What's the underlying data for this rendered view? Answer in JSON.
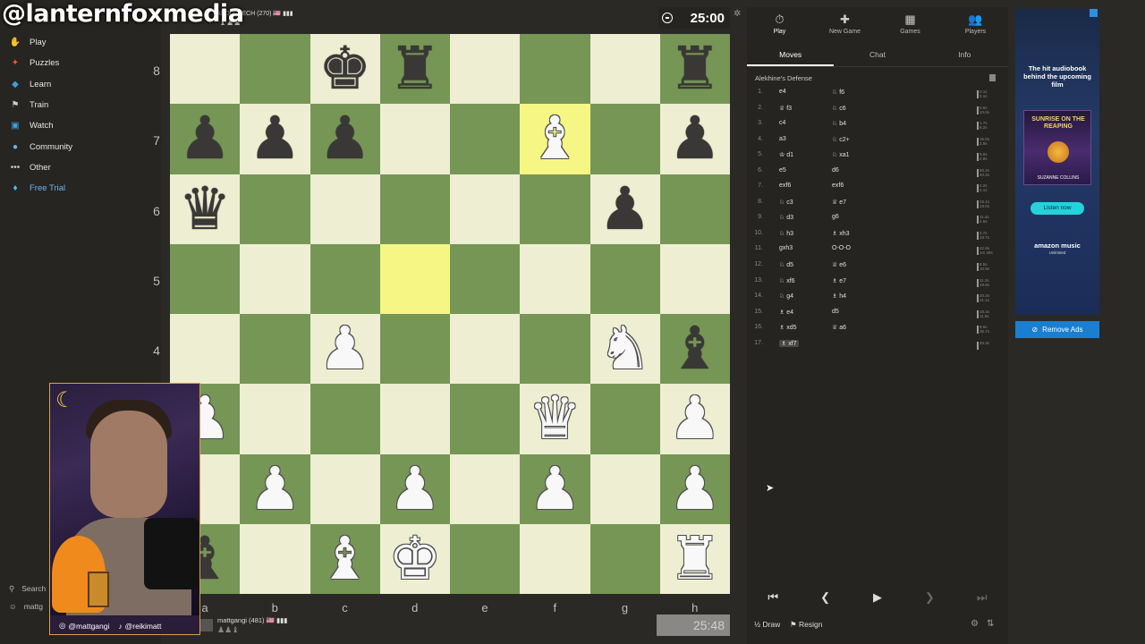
{
  "watermark": "@lanternfoxmedia",
  "nav": {
    "items": [
      {
        "label": "Play",
        "icon": "play-hand-icon",
        "glyph": "✋",
        "color": "#f0a03c"
      },
      {
        "label": "Puzzles",
        "icon": "puzzle-icon",
        "glyph": "✦",
        "color": "#e8593a"
      },
      {
        "label": "Learn",
        "icon": "learn-icon",
        "glyph": "◆",
        "color": "#3aa0e0"
      },
      {
        "label": "Train",
        "icon": "train-icon",
        "glyph": "⚑",
        "color": "#c9c9c9"
      },
      {
        "label": "Watch",
        "icon": "watch-icon",
        "glyph": "▣",
        "color": "#3aa0e0"
      },
      {
        "label": "Community",
        "icon": "community-icon",
        "glyph": "●",
        "color": "#6fb3e8"
      },
      {
        "label": "Other",
        "icon": "more-icon",
        "glyph": "•••",
        "color": "#c9c9c9"
      },
      {
        "label": "Free Trial",
        "icon": "diamond-icon",
        "glyph": "♦",
        "color": "#3ac8e8"
      }
    ],
    "search": "Search",
    "user": "mattg"
  },
  "opponent": {
    "name": "ANDO_TECH (270) 🇺🇸 ▮▮▮",
    "captured": "♝♟♟"
  },
  "clock_top": "25:00",
  "board": {
    "ranks": [
      "8",
      "7",
      "6",
      "5",
      "4",
      "3",
      "2",
      "1"
    ],
    "files": [
      "a",
      "b",
      "c",
      "d",
      "e",
      "f",
      "g",
      "h"
    ],
    "rows": [
      [
        "",
        "",
        "bk",
        "br",
        "",
        "",
        "",
        "br"
      ],
      [
        "bp",
        "bp",
        "bp",
        "",
        "",
        "wb",
        "",
        "bp"
      ],
      [
        "bq",
        "",
        "",
        "",
        "",
        "",
        "bp",
        ""
      ],
      [
        "",
        "",
        "",
        "",
        "",
        "",
        "",
        ""
      ],
      [
        "",
        "",
        "wp",
        "",
        "",
        "",
        "wn",
        "bb"
      ],
      [
        "wp",
        "",
        "",
        "",
        "",
        "wq",
        "",
        "wp"
      ],
      [
        "",
        "wp",
        "",
        "wp",
        "",
        "wp",
        "",
        "wp"
      ],
      [
        "bb",
        "",
        "wb",
        "wk",
        "",
        "",
        "",
        "wr"
      ]
    ],
    "highlights": [
      [
        1,
        5
      ],
      [
        3,
        3
      ]
    ]
  },
  "me": {
    "name": "mattgangi (481) 🇺🇸 ▮▮▮",
    "captured": "♟♟♝"
  },
  "clock_bottom": "25:48",
  "webcam": {
    "handle1": "@mattgangi",
    "handle2": "@reikimatt"
  },
  "panel": {
    "tabs": [
      {
        "label": "Play",
        "glyph": "⏱"
      },
      {
        "label": "New Game",
        "glyph": "✚"
      },
      {
        "label": "Games",
        "glyph": "▦"
      },
      {
        "label": "Players",
        "glyph": "👥"
      }
    ],
    "subtabs": [
      "Moves",
      "Chat",
      "Info"
    ],
    "opening": "Alekhine's Defense",
    "moves": [
      {
        "n": "1.",
        "w": "e4",
        "b": "♘ f6",
        "t1": "0.1s",
        "t2": "0.1s"
      },
      {
        "n": "2.",
        "w": "♕ f3",
        "b": "♘ c6",
        "t1": "5.6s",
        "t2": "10.0s"
      },
      {
        "n": "3.",
        "w": "c4",
        "b": "♘ b4",
        "t1": "1.7s",
        "t2": "8.2s"
      },
      {
        "n": "4.",
        "w": "a3",
        "b": "♘ c2+",
        "t1": "15.0s",
        "t2": "2.9s"
      },
      {
        "n": "5.",
        "w": "♔ d1",
        "b": "♘ xa1",
        "t1": "9.0s",
        "t2": "2.8s"
      },
      {
        "n": "6.",
        "w": "e5",
        "b": "d6",
        "t1": "50.2s",
        "t2": "40.2s"
      },
      {
        "n": "7.",
        "w": "exf6",
        "b": "exf6",
        "t1": "4.2s",
        "t2": "4.1s"
      },
      {
        "n": "8.",
        "w": "♘ c3",
        "b": "♕ e7",
        "t1": "15.1s",
        "t2": "19.0s"
      },
      {
        "n": "9.",
        "w": "♘ d3",
        "b": "g6",
        "t1": "11.4s",
        "t2": "4.6s"
      },
      {
        "n": "10.",
        "w": "♘ h3",
        "b": "♗ xh3",
        "t1": "3.7s",
        "t2": "19.7s"
      },
      {
        "n": "11.",
        "w": "gxh3",
        "b": "O-O-O",
        "t1": "42.8s",
        "t2": "1m 28s"
      },
      {
        "n": "12.",
        "w": "♘ d5",
        "b": "♕ e6",
        "t1": "8.5s",
        "t2": "10.9s"
      },
      {
        "n": "13.",
        "w": "♘ xf6",
        "b": "♗ e7",
        "t1": "11.3s",
        "t2": "19.8s"
      },
      {
        "n": "14.",
        "w": "♘ g4",
        "b": "♗ h4",
        "t1": "20.2s",
        "t2": "21.1s"
      },
      {
        "n": "15.",
        "w": "♗ e4",
        "b": "d5",
        "t1": "18.4s",
        "t2": "11.5s"
      },
      {
        "n": "16.",
        "w": "♗ xd5",
        "b": "♕ a6",
        "t1": "8.6s",
        "t2": "36.7s"
      },
      {
        "n": "17.",
        "w": "♗ xf7",
        "b": "",
        "t1": "46.3s",
        "t2": ""
      }
    ],
    "actions": {
      "draw": "Draw",
      "resign": "Resign"
    }
  },
  "ad": {
    "headline": "The hit audiobook behind the upcoming film",
    "book_title": "SUNRISE ON THE REAPING",
    "author": "SUZANNE COLLINS",
    "cta": "Listen now",
    "brand": "amazon music",
    "brand_sub": "Unlimited",
    "remove": "Remove Ads"
  }
}
